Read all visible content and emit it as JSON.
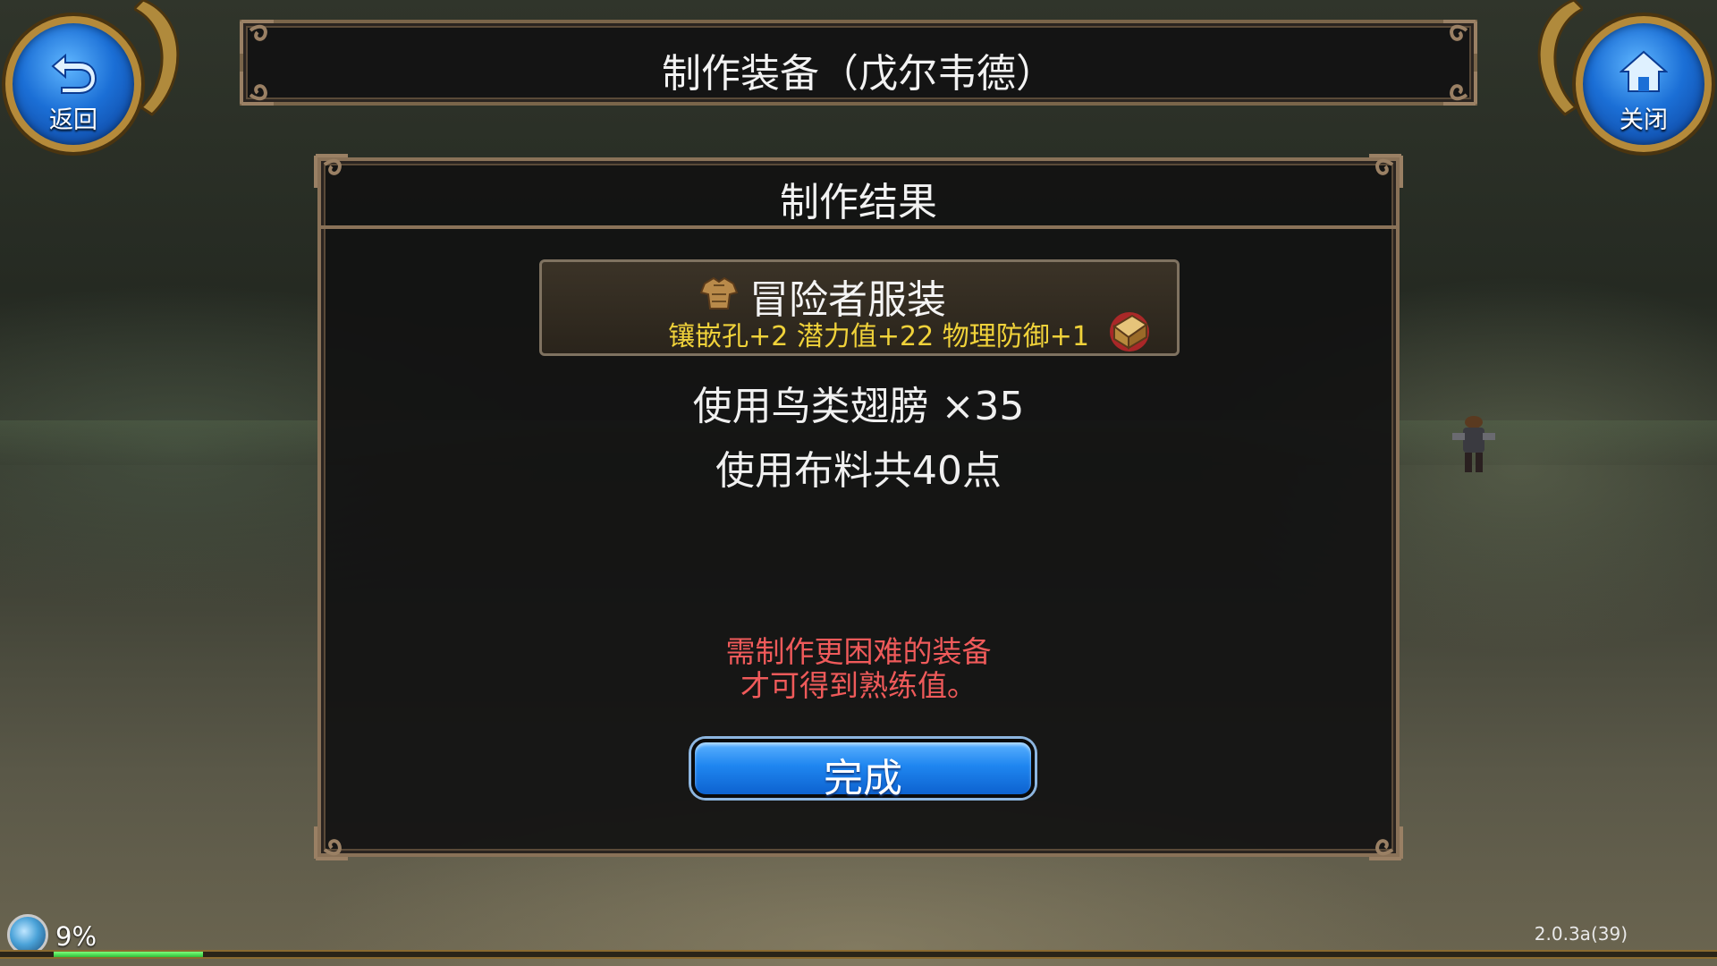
{
  "window": {
    "title": "制作装备（戊尔韦德）"
  },
  "nav": {
    "back_label": "返回",
    "close_label": "关闭"
  },
  "dialog": {
    "title": "制作结果",
    "item": {
      "name": "冒险者服装",
      "stats": "镶嵌孔+2 潜力值+22 物理防御+1",
      "icon": "armor-icon",
      "chest_icon": "treasure-chest-icon"
    },
    "use_materials": "使用鸟类翅膀 ×35",
    "use_cloth": "使用布料共40点",
    "warning_line1": "需制作更困难的装备",
    "warning_line2": "才可得到熟练值。",
    "done_label": "完成"
  },
  "hud": {
    "exp_percent_text": "9%",
    "exp_fraction": 0.09,
    "version": "2.0.3a(39)"
  },
  "colors": {
    "stat_yellow": "#f0d23a",
    "warning_red": "#ef5a5a",
    "button_blue": "#1f86f0",
    "frame_bronze": "#8a7258"
  }
}
